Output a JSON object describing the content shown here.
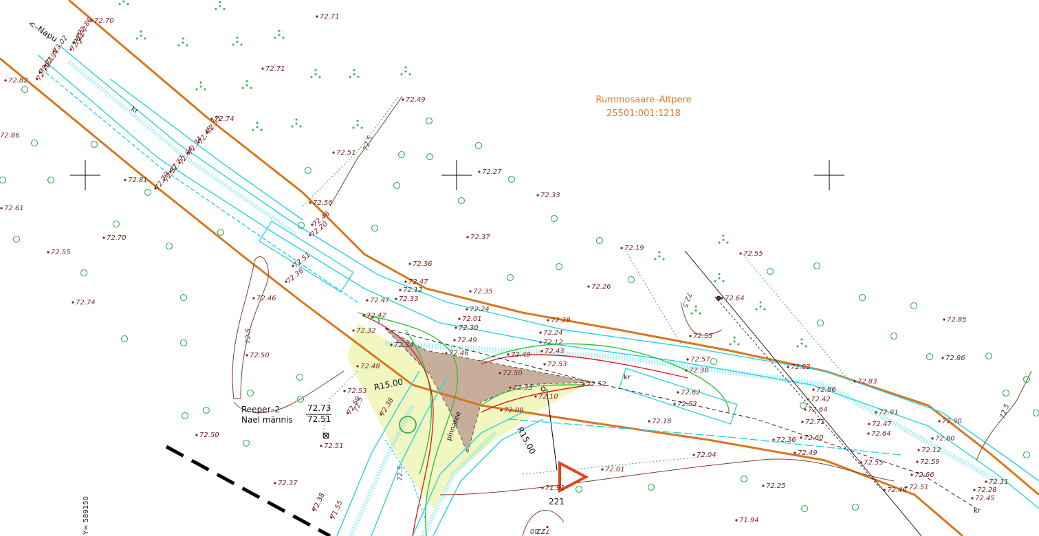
{
  "map": {
    "parcel": {
      "name": "Rummosaare–Altpere",
      "code": "25501:001:1218"
    },
    "road_direction": "<–Napu",
    "benchmark": {
      "name": "Reeper–2",
      "desc": "Nael männis",
      "elev_top": "72.73",
      "elev_bottom": "72.51"
    },
    "radius_labels": [
      "R15.00",
      "R15.00"
    ],
    "sign_number": "221",
    "coord_label": "Y= 589150",
    "road_surface": "kr",
    "road_surface_2": "kr",
    "path_label": "pinnatee",
    "elevations": [
      {
        "t": "72.70"
      },
      {
        "t": "72.86"
      },
      {
        "t": "72.77"
      },
      {
        "t": "72.94"
      },
      {
        "t": "73.02"
      },
      {
        "t": "72.94"
      },
      {
        "t": "72.71"
      },
      {
        "t": "72.79"
      },
      {
        "t": "72.82"
      },
      {
        "t": "72.86"
      },
      {
        "t": "72.71"
      },
      {
        "t": "72.71"
      },
      {
        "t": "72.49"
      },
      {
        "t": "72.74"
      },
      {
        "t": "72.55"
      },
      {
        "t": "72.45"
      },
      {
        "t": "72.74"
      },
      {
        "t": "72.64"
      },
      {
        "t": "72.77"
      },
      {
        "t": "72.57"
      },
      {
        "t": "72.79"
      },
      {
        "t": "72.81"
      },
      {
        "t": "72.61"
      },
      {
        "t": "72.51"
      },
      {
        "t": "72.27"
      },
      {
        "t": "72.33"
      },
      {
        "t": "72.56"
      },
      {
        "t": "72.46"
      },
      {
        "t": "72.20"
      },
      {
        "t": "72.37"
      },
      {
        "t": "72.70"
      },
      {
        "t": "72.55"
      },
      {
        "t": "72.19"
      },
      {
        "t": "72.55"
      },
      {
        "t": "72.36"
      },
      {
        "t": "72.47"
      },
      {
        "t": "72.12"
      },
      {
        "t": "72.33"
      },
      {
        "t": "72.35"
      },
      {
        "t": "72.26"
      },
      {
        "t": "72.74"
      },
      {
        "t": "72.46"
      },
      {
        "t": "72.51"
      },
      {
        "t": "72.36"
      },
      {
        "t": "72.64"
      },
      {
        "t": "72.47"
      },
      {
        "t": "72.42"
      },
      {
        "t": "72.32"
      },
      {
        "t": "72.24"
      },
      {
        "t": "72.01"
      },
      {
        "t": "72.30"
      },
      {
        "t": "72.28"
      },
      {
        "t": "72.24"
      },
      {
        "t": "72.12"
      },
      {
        "t": "72.43"
      },
      {
        "t": "72.55"
      },
      {
        "t": "72.85"
      },
      {
        "t": "72.34"
      },
      {
        "t": "72.49"
      },
      {
        "t": "72.46"
      },
      {
        "t": "72.49"
      },
      {
        "t": "72.53"
      },
      {
        "t": "72.57"
      },
      {
        "t": "72.30"
      },
      {
        "t": "72.82"
      },
      {
        "t": "72.86"
      },
      {
        "t": "72.50"
      },
      {
        "t": "72.48"
      },
      {
        "t": "72.50"
      },
      {
        "t": "72.52"
      },
      {
        "t": "72.62"
      },
      {
        "t": "72.53"
      },
      {
        "t": "72.83"
      },
      {
        "t": "72.86"
      },
      {
        "t": "72.53"
      },
      {
        "t": "72.33"
      },
      {
        "t": "72.10"
      },
      {
        "t": "72.42"
      },
      {
        "t": "72.64"
      },
      {
        "t": "72.91"
      },
      {
        "t": "72.50"
      },
      {
        "t": "72.38"
      },
      {
        "t": "72.09"
      },
      {
        "t": "72.71"
      },
      {
        "t": "72.18"
      },
      {
        "t": "72.47"
      },
      {
        "t": "72.90"
      },
      {
        "t": "72.60"
      },
      {
        "t": "72.64"
      },
      {
        "t": "72.80"
      },
      {
        "t": "72.36"
      },
      {
        "t": "72.49"
      },
      {
        "t": "72.12"
      },
      {
        "t": "72.50"
      },
      {
        "t": "72.51"
      },
      {
        "t": "72.04"
      },
      {
        "t": "72.55"
      },
      {
        "t": "72.59"
      },
      {
        "t": "72.37"
      },
      {
        "t": "72.01"
      },
      {
        "t": "72.66"
      },
      {
        "t": "72.25"
      },
      {
        "t": "72.46"
      },
      {
        "t": "72.51"
      },
      {
        "t": "72.31"
      },
      {
        "t": "72.38"
      },
      {
        "t": "71.91"
      },
      {
        "t": "72.28"
      },
      {
        "t": "72.45"
      },
      {
        "t": "71.55"
      },
      {
        "t": "71.94"
      },
      {
        "t": "72.0"
      }
    ],
    "contours": [
      {
        "t": "72.5"
      },
      {
        "t": "72.5"
      },
      {
        "t": "72.5"
      },
      {
        "t": "72.5"
      },
      {
        "t": "72.5"
      },
      {
        "t": "72.5"
      },
      {
        "t": "72.0"
      }
    ]
  }
}
